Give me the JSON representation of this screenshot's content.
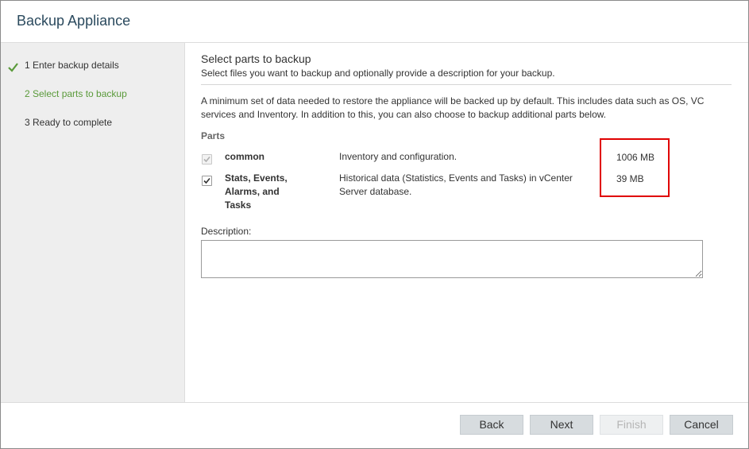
{
  "dialog": {
    "title": "Backup Appliance"
  },
  "steps": [
    {
      "label": "1 Enter backup details",
      "state": "completed"
    },
    {
      "label": "2 Select parts to backup",
      "state": "active"
    },
    {
      "label": "3 Ready to complete",
      "state": "pending"
    }
  ],
  "main": {
    "heading": "Select parts to backup",
    "subheading": "Select files you want to backup and optionally provide a description for your backup.",
    "info": "A minimum set of data needed to restore the appliance will be backed up by default. This includes data such as OS, VC services and Inventory. In addition to this, you can also choose to backup additional parts below.",
    "parts_label": "Parts",
    "parts": [
      {
        "name": "common",
        "description": "Inventory and configuration.",
        "size": "1006 MB",
        "checked": true,
        "disabled": true
      },
      {
        "name": "Stats, Events, Alarms, and Tasks",
        "description": "Historical data (Statistics, Events and Tasks) in vCenter Server database.",
        "size": "39 MB",
        "checked": true,
        "disabled": false
      }
    ],
    "description_label": "Description:",
    "description_value": ""
  },
  "footer": {
    "back": "Back",
    "next": "Next",
    "finish": "Finish",
    "cancel": "Cancel"
  },
  "colors": {
    "accent_green": "#5a9a3a",
    "highlight_red": "#e00000",
    "title_blue": "#2b4a5e"
  }
}
